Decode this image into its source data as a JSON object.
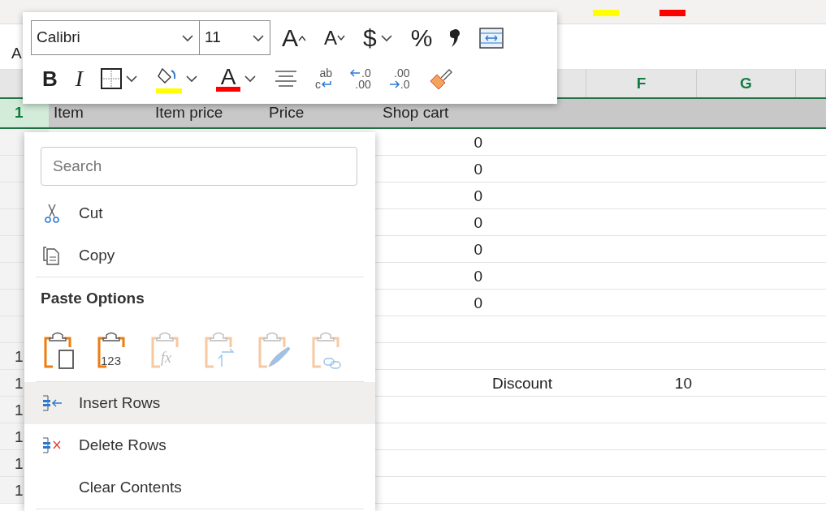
{
  "ribbon": {
    "swatches": [
      {
        "color": "#ffff00"
      },
      {
        "color": "#ff0000"
      }
    ]
  },
  "name_box": {
    "value": "A"
  },
  "column_headers": [
    {
      "label": "F"
    },
    {
      "label": "G"
    }
  ],
  "rows": [
    {
      "header": "1",
      "selected": true,
      "cells": [
        {
          "text": "Item",
          "kind": "text"
        },
        {
          "text": "Item price",
          "kind": "text"
        },
        {
          "text": "Price",
          "kind": "text"
        },
        {
          "text": "Shop cart",
          "kind": "text"
        }
      ]
    },
    {
      "selected": false,
      "cells": [
        null,
        null,
        null,
        {
          "text": "0",
          "kind": "number"
        }
      ]
    },
    {
      "selected": false,
      "cells": [
        null,
        null,
        null,
        {
          "text": "0",
          "kind": "number"
        }
      ]
    },
    {
      "selected": false,
      "cells": [
        null,
        null,
        null,
        {
          "text": "0",
          "kind": "number"
        }
      ]
    },
    {
      "selected": false,
      "cells": [
        null,
        null,
        null,
        {
          "text": "0",
          "kind": "number"
        }
      ]
    },
    {
      "selected": false,
      "cells": [
        null,
        null,
        null,
        {
          "text": "0",
          "kind": "number"
        }
      ]
    },
    {
      "selected": false,
      "cells": [
        null,
        null,
        null,
        {
          "text": "0",
          "kind": "number"
        }
      ]
    },
    {
      "selected": false,
      "cells": [
        null,
        null,
        null,
        {
          "text": "0",
          "kind": "number"
        }
      ]
    },
    {
      "selected": false,
      "cells": []
    },
    {
      "header": "1",
      "selected": false,
      "cells": []
    },
    {
      "header": "1",
      "selected": false,
      "cells": [
        null,
        null,
        null,
        null,
        {
          "text": "Discount",
          "kind": "text"
        },
        {
          "text": "10",
          "kind": "number"
        }
      ]
    },
    {
      "header": "1",
      "selected": false,
      "cells": []
    },
    {
      "header": "1",
      "selected": false,
      "cells": []
    },
    {
      "header": "1",
      "selected": false,
      "cells": []
    },
    {
      "header": "1",
      "selected": false,
      "cells": []
    }
  ],
  "mini_toolbar": {
    "font": {
      "value": "Calibri"
    },
    "size": {
      "value": "11"
    },
    "row1": [
      {
        "kind": "grow",
        "label": "A",
        "dropdown": false
      },
      {
        "kind": "shrink",
        "label": "A",
        "dropdown": false
      },
      {
        "kind": "currency",
        "label": "$",
        "dropdown": true
      },
      {
        "kind": "percent",
        "label": "%",
        "dropdown": false
      },
      {
        "kind": "comma",
        "dropdown": false
      },
      {
        "kind": "merge",
        "dropdown": false
      }
    ],
    "row2": [
      {
        "kind": "bold",
        "label": "B",
        "dropdown": false
      },
      {
        "kind": "italic",
        "label": "I",
        "dropdown": false
      },
      {
        "kind": "borders",
        "dropdown": true
      },
      {
        "kind": "fill",
        "color": "#ffff00",
        "dropdown": true
      },
      {
        "kind": "font-color",
        "label": "A",
        "color": "#ff0000",
        "dropdown": true
      },
      {
        "kind": "align",
        "dropdown": false
      },
      {
        "kind": "wrap",
        "top": "ab",
        "bottom": "c",
        "dropdown": false
      },
      {
        "kind": "decimal-decrease",
        "top": ".0",
        "bottom": ".00",
        "dropdown": false
      },
      {
        "kind": "decimal-increase",
        "top": ".00",
        "bottom": ".0",
        "dropdown": false
      },
      {
        "kind": "painter",
        "dropdown": false
      }
    ]
  },
  "context_menu": {
    "search": {
      "placeholder": "Search"
    },
    "items": [
      {
        "kind": "cut",
        "label": "Cut",
        "selected": false
      },
      {
        "kind": "copy",
        "label": "Copy",
        "selected": false
      },
      {
        "kind": "separator"
      },
      {
        "kind": "header",
        "label": "Paste Options"
      },
      {
        "kind": "paste",
        "options": [
          {
            "kind": "keep",
            "disabled": false
          },
          {
            "kind": "values",
            "glyph": "123",
            "disabled": false
          },
          {
            "kind": "formulas",
            "glyph": "fx",
            "disabled": true
          },
          {
            "kind": "transpose",
            "disabled": true
          },
          {
            "kind": "formatting",
            "disabled": true
          },
          {
            "kind": "link",
            "disabled": true
          }
        ]
      },
      {
        "kind": "separator"
      },
      {
        "kind": "insert",
        "label": "Insert Rows",
        "selected": true
      },
      {
        "kind": "delete",
        "label": "Delete Rows",
        "selected": false
      },
      {
        "kind": "clear",
        "label": "Clear Contents",
        "selected": false
      },
      {
        "kind": "separator"
      }
    ]
  }
}
